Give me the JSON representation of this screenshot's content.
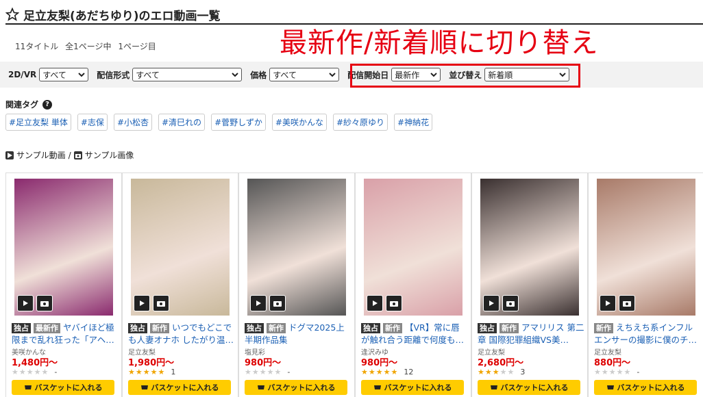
{
  "header": {
    "title": "足立友梨(あだちゆり)のエロ動画一覧"
  },
  "overlay": {
    "text": "最新作/新着順に切り替え"
  },
  "counts": {
    "titles": "11タイトル",
    "pages": "全1ページ中",
    "current": "1ページ目"
  },
  "filters": {
    "vr_label": "2D/VR",
    "vr_value": "すべて",
    "format_label": "配信形式",
    "format_value": "すべて",
    "price_label": "価格",
    "price_value": "すべて",
    "date_label": "配信開始日",
    "date_value": "最新作",
    "sort_label": "並び替え",
    "sort_value": "新着順"
  },
  "tags_title": "関連タグ",
  "tags": [
    "#足立友梨 単体",
    "#志保",
    "#小松杏",
    "#清巳れの",
    "#菅野しずか",
    "#美咲かんな",
    "#紗々原ゆり",
    "#神納花"
  ],
  "legend": {
    "movie": "サンプル動画",
    "sep": "/",
    "image": "サンプル画像"
  },
  "basket_label": "バスケットに入れる",
  "cards": [
    {
      "title": "独占 最新作 ヤバイほど極限まで乱れ狂った「アヘ…",
      "actress": "美咲かんな",
      "price": "1,480円〜",
      "stars": 0,
      "count": "-",
      "badges": [
        "独占",
        "最新作"
      ],
      "title_text": "ヤバイほど極限まで乱れ狂った「アヘ…",
      "thumb_color": "#8a2a6e"
    },
    {
      "title": "いつでもどこでも人妻オナホ したがり温…",
      "actress": "足立友梨",
      "price": "1,980円〜",
      "stars": 5,
      "count": "1",
      "badges": [
        "独占",
        "新作"
      ],
      "title_text": "いつでもどこでも人妻オナホ したがり温…",
      "thumb_color": "#c8b89a"
    },
    {
      "title": "ドグマ2025上半期作品集",
      "actress": "塩見彩",
      "price": "980円〜",
      "stars": 0,
      "count": "-",
      "badges": [
        "独占",
        "新作"
      ],
      "title_text": "ドグマ2025上半期作品集",
      "thumb_color": "#555555"
    },
    {
      "title": "【VR】常に唇が触れ合う距離で何度も…",
      "actress": "逢沢みゆ",
      "price": "980円〜",
      "stars": 4.5,
      "count": "12",
      "badges": [
        "独占",
        "新作"
      ],
      "title_text": "【VR】常に唇が触れ合う距離で何度も…",
      "thumb_color": "#d9a0a8"
    },
    {
      "title": "アマリリス 第二章 国際犯罪組織VS美…",
      "actress": "足立友梨",
      "price": "2,680円〜",
      "stars": 3,
      "count": "3",
      "badges": [
        "独占",
        "新作"
      ],
      "title_text": "アマリリス 第二章 国際犯罪組織VS美…",
      "thumb_color": "#3a3030"
    },
    {
      "title": "えちえち系インフルエンサーの撮影に僕のチ…",
      "actress": "足立友梨",
      "price": "880円〜",
      "stars": 0,
      "count": "-",
      "badges": [
        "新作"
      ],
      "title_text": "えちえち系インフルエンサーの撮影に僕のチ…",
      "thumb_color": "#a87a68"
    }
  ],
  "colors": {
    "accent_red": "#e60012",
    "link_blue": "#1a5fb4",
    "basket_yellow": "#ffcc00"
  }
}
